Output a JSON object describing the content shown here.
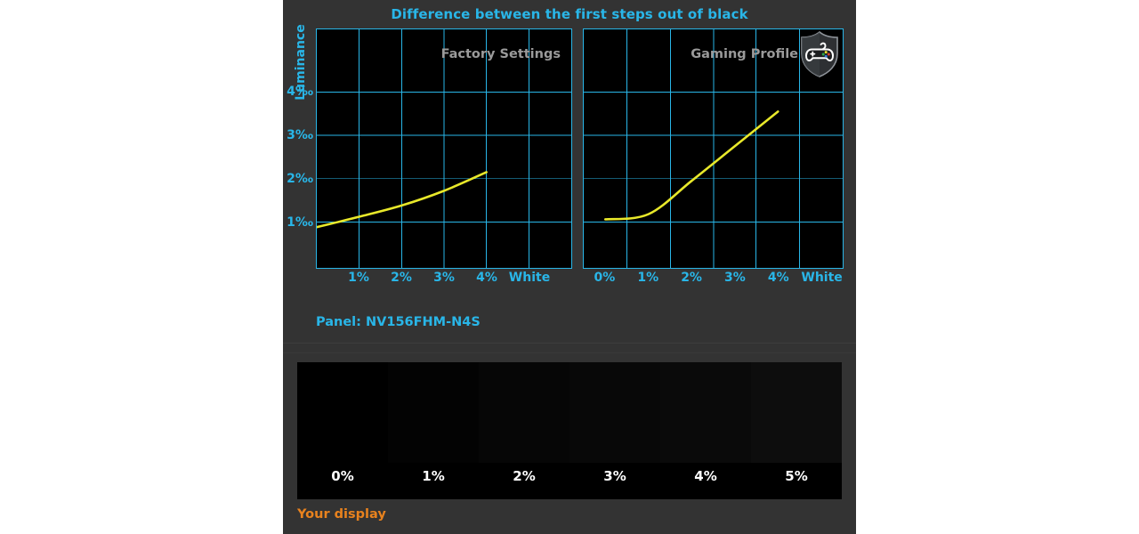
{
  "chart_title": "Difference between the first steps out of black",
  "panel_model": "Panel: NV156FHM-N4S",
  "your_display_label": "Your display",
  "colors": {
    "accent_blue": "#29b6e8",
    "curve_yellow": "#e8e82a",
    "orange": "#e8821e",
    "panel_bg": "#333333",
    "plot_bg": "#000000",
    "plot_label_gray": "#9a9a9a"
  },
  "icons": {
    "gaming_shield": "shield-gamepad-icon"
  },
  "axis": {
    "ylabel": "Luminance",
    "yticks": [
      "1‰",
      "2‰",
      "3‰",
      "4‰"
    ],
    "ytick_values": [
      1,
      2,
      3,
      4
    ]
  },
  "chart_data": [
    {
      "type": "line",
      "title": "Factory Settings",
      "xlabel": "",
      "ylabel": "Luminance",
      "categories": [
        "0%",
        "1%",
        "2%",
        "3%",
        "4%",
        "White"
      ],
      "xtick_labels": [
        "1%",
        "2%",
        "3%",
        "4%",
        "White"
      ],
      "ylim": [
        0,
        5.5
      ],
      "xlim": [
        0,
        6
      ],
      "grid": true,
      "line_color": "#e8e82a",
      "x": [
        0,
        1,
        2,
        3,
        4
      ],
      "values": [
        0.88,
        1.12,
        1.38,
        1.72,
        2.15
      ]
    },
    {
      "type": "line",
      "title": "Gaming Profile",
      "xlabel": "",
      "ylabel": "Luminance",
      "categories": [
        "0%",
        "1%",
        "2%",
        "3%",
        "4%",
        "White"
      ],
      "xtick_labels": [
        "0%",
        "1%",
        "2%",
        "3%",
        "4%",
        "White"
      ],
      "ylim": [
        0,
        5.5
      ],
      "xlim": [
        0,
        6
      ],
      "grid": true,
      "line_color": "#e8e82a",
      "x": [
        0,
        1,
        2,
        3,
        4
      ],
      "values": [
        1.06,
        1.18,
        1.95,
        2.75,
        3.55
      ]
    }
  ],
  "gradient_strip": {
    "steps": [
      {
        "label": "0%",
        "color": "#000000"
      },
      {
        "label": "1%",
        "color": "#030303"
      },
      {
        "label": "2%",
        "color": "#060606"
      },
      {
        "label": "3%",
        "color": "#080808"
      },
      {
        "label": "4%",
        "color": "#0a0a0a"
      },
      {
        "label": "5%",
        "color": "#0d0d0d"
      }
    ]
  }
}
